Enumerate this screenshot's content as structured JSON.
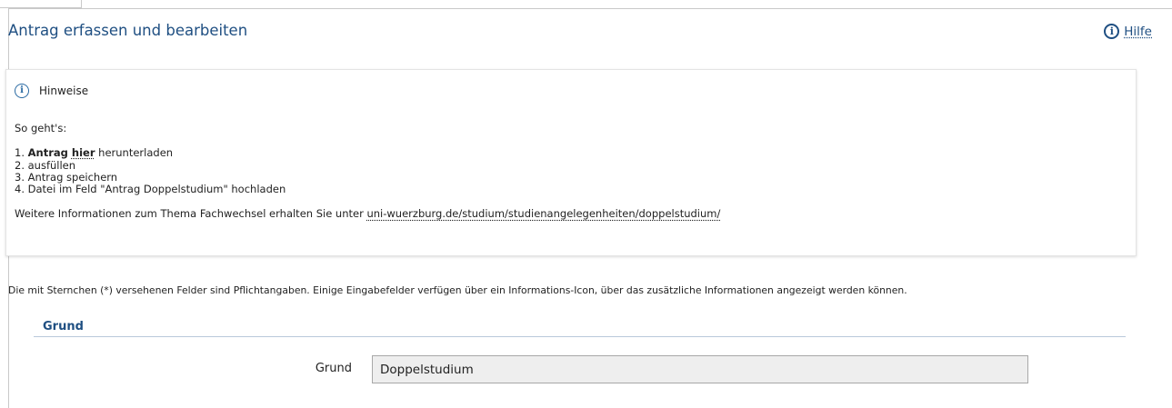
{
  "header": {
    "title": "Antrag erfassen und bearbeiten",
    "help_label": "Hilfe"
  },
  "notice": {
    "title": "Hinweise",
    "intro": "So geht's:",
    "step1_num": "1. ",
    "step1_bold": "Antrag ",
    "step1_link": "hier",
    "step1_rest": " herunterladen",
    "step2": "2. ausfüllen",
    "step3": "3. Antrag speichern",
    "step4": "4. Datei im Feld \"Antrag Doppelstudium\" hochladen",
    "more_info_prefix": "Weitere Informationen zum Thema Fachwechsel erhalten Sie unter ",
    "more_info_link": "uni-wuerzburg.de/studium/studienangelegenheiten/doppelstudium/"
  },
  "form": {
    "required_note": "Die mit Sternchen (*) versehenen Felder sind Pflichtangaben. Einige Eingabefelder verfügen über ein Informations-Icon, über das zusätzliche Informationen angezeigt werden können.",
    "section_title": "Grund",
    "field_label": "Grund",
    "field_value": "Doppelstudium"
  }
}
